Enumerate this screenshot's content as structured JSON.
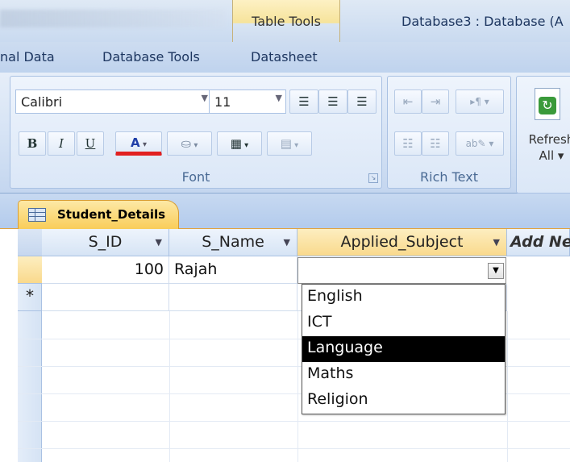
{
  "ribbon": {
    "contextual_tab": "Table Tools",
    "window_title": "Database3 : Database (A",
    "tabs": [
      "nal Data",
      "Database Tools",
      "Datasheet"
    ],
    "font_group": {
      "label": "Font",
      "font_name": "Calibri",
      "font_size": "11",
      "bold": "B",
      "italic": "I",
      "underline": "U",
      "font_color": "A"
    },
    "richtext_group": {
      "label": "Rich Text"
    },
    "refresh": {
      "label_line1": "Refresh",
      "label_line2": "All ▾"
    }
  },
  "document": {
    "tab_title": "Student_Details",
    "columns": [
      "S_ID",
      "S_Name",
      "Applied_Subject",
      "Add Ne"
    ],
    "rows": [
      {
        "S_ID": "100",
        "S_Name": "Rajah",
        "Applied_Subject": ""
      }
    ],
    "new_row_marker": "*"
  },
  "dropdown": {
    "options": [
      "English",
      "ICT",
      "Language",
      "Maths",
      "Religion"
    ],
    "highlighted": "Language"
  }
}
